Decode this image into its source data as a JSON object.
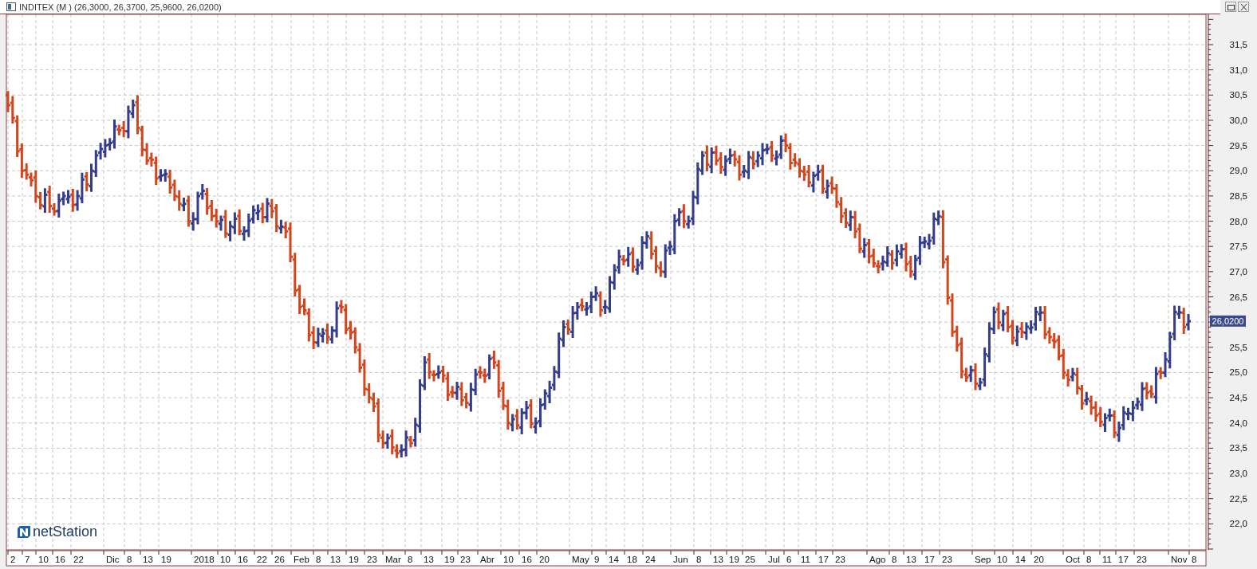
{
  "window": {
    "title": "INDITEX (M ) (26,3000, 26,3700, 25,9600, 26,0200)"
  },
  "chart": {
    "logo": "netStation",
    "x_axis_labels": [
      "2",
      "7",
      "10",
      "16",
      "22",
      "Dic",
      "8",
      "13",
      "19",
      "2018",
      "10",
      "16",
      "22",
      "26",
      "Feb",
      "8",
      "13",
      "19",
      "23",
      "Mar",
      "8",
      "13",
      "19",
      "23",
      "Abr",
      "10",
      "16",
      "20",
      "May",
      "9",
      "14",
      "18",
      "24",
      "Jun",
      "8",
      "13",
      "19",
      "25",
      "Jul",
      "6",
      "11",
      "17",
      "23",
      "Ago",
      "8",
      "13",
      "17",
      "23",
      "Sep",
      "10",
      "14",
      "20",
      "Oct",
      "8",
      "11",
      "17",
      "23",
      "Nov",
      "8"
    ],
    "y_axis_labels": [
      "31,5",
      "31,0",
      "30,5",
      "30,0",
      "29,5",
      "29,0",
      "28,5",
      "28,0",
      "27,5",
      "27,0",
      "26,5",
      "25,5",
      "25,0",
      "24,5",
      "24,0",
      "23,5",
      "23,0",
      "22,5",
      "22,0"
    ],
    "last_price": "26,0200"
  }
}
